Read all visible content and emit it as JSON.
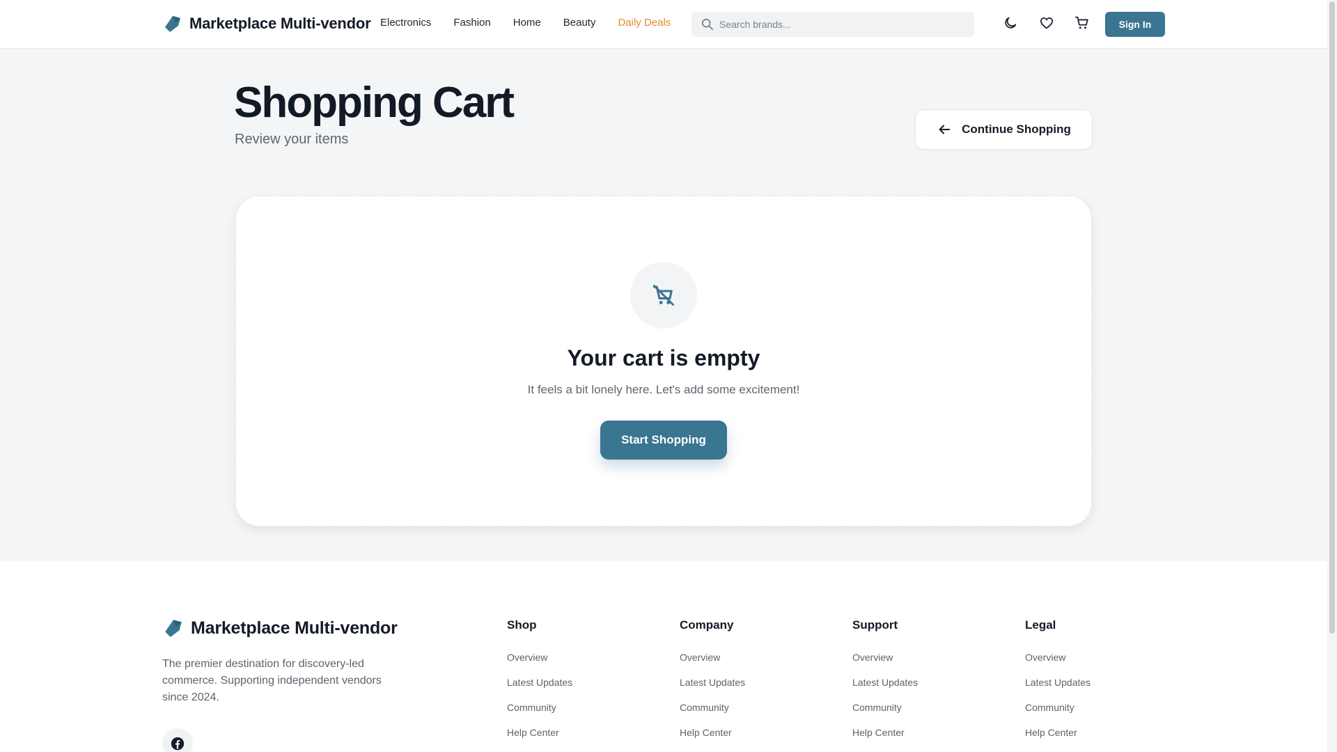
{
  "header": {
    "brand": "Marketplace Multi-vendor",
    "nav": [
      "Electronics",
      "Fashion",
      "Home",
      "Beauty",
      "Daily Deals"
    ],
    "search_placeholder": "Search brands...",
    "sign_in_label": "Sign In",
    "icons": [
      "theme-toggle-moon-icon",
      "wishlist-heart-icon",
      "cart-icon"
    ]
  },
  "main": {
    "title": "Shopping Cart",
    "subtitle": "Review your items",
    "continue_label": "Continue Shopping",
    "empty": {
      "title": "Your cart is empty",
      "text": "It feels a bit lonely here. Let's add some excitement!",
      "button": "Start Shopping",
      "icon": "cart-off-icon"
    }
  },
  "footer": {
    "brand": "Marketplace Multi-vendor",
    "description": "The premier destination for discovery-led commerce. Supporting independent vendors since 2024.",
    "social_icon": "facebook-icon",
    "columns": [
      {
        "title": "Shop",
        "links": [
          "Overview",
          "Latest Updates",
          "Community",
          "Help Center"
        ]
      },
      {
        "title": "Company",
        "links": [
          "Overview",
          "Latest Updates",
          "Community",
          "Help Center"
        ]
      },
      {
        "title": "Support",
        "links": [
          "Overview",
          "Latest Updates",
          "Community",
          "Help Center"
        ]
      },
      {
        "title": "Legal",
        "links": [
          "Overview",
          "Latest Updates",
          "Community",
          "Help Center"
        ]
      }
    ]
  },
  "colors": {
    "primary": "#3a7592",
    "deal": "#e08c2e",
    "text_dark": "#141b26",
    "page_bg": "#f4f5f6"
  }
}
